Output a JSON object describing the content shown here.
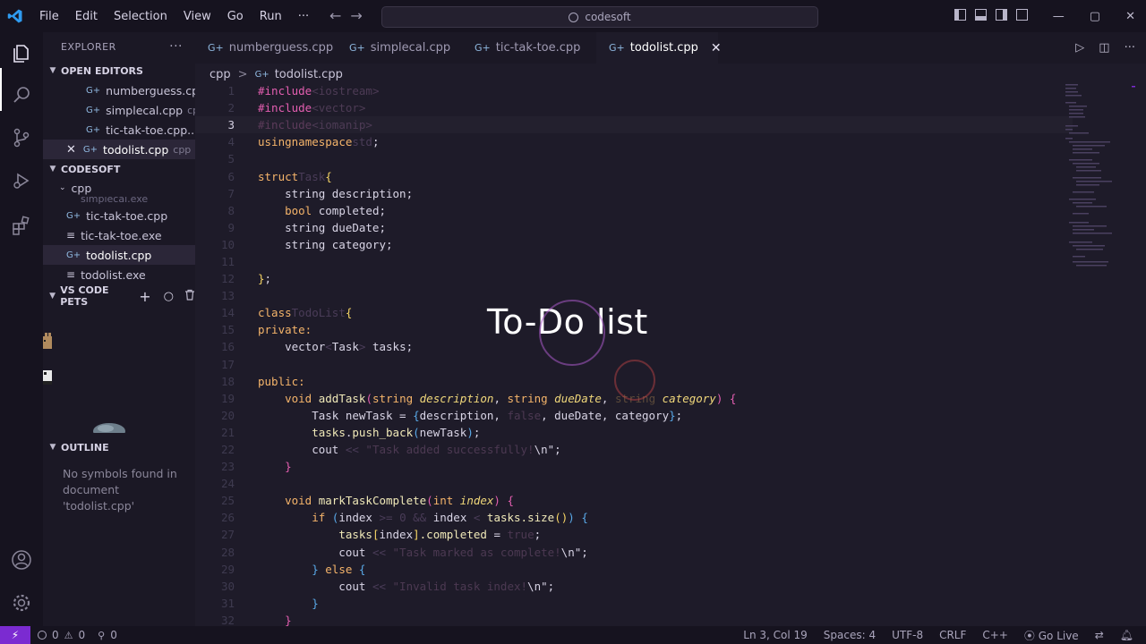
{
  "menu": {
    "file": "File",
    "edit": "Edit",
    "selection": "Selection",
    "view": "View",
    "go": "Go",
    "run": "Run",
    "more": "···"
  },
  "nav": {
    "back": "←",
    "forward": "→"
  },
  "command_center": {
    "text": "codesoft"
  },
  "window": {
    "minimize": "—",
    "maximize": "▢",
    "close": "✕"
  },
  "sidebar": {
    "title": "EXPLORER",
    "title_more": "···",
    "open_editors": {
      "label": "OPEN EDITORS",
      "items": [
        {
          "name": "numberguess.cp...",
          "meta": ""
        },
        {
          "name": "simplecal.cpp",
          "meta": "cpp"
        },
        {
          "name": "tic-tak-toe.cpp...",
          "meta": ""
        },
        {
          "name": "todolist.cpp",
          "meta": "cpp"
        }
      ]
    },
    "workspace": {
      "label": "CODESOFT",
      "folder": "cpp",
      "files": [
        {
          "name": "simplecal.exe"
        },
        {
          "name": "tic-tak-toe.cpp"
        },
        {
          "name": "tic-tak-toe.exe"
        },
        {
          "name": "todolist.cpp"
        },
        {
          "name": "todolist.exe"
        }
      ]
    },
    "pets": {
      "label": "VS CODE PETS",
      "add": "+",
      "ball": "○",
      "trash": "🗑"
    },
    "outline": {
      "label": "OUTLINE",
      "message": "No symbols found in document 'todolist.cpp'"
    }
  },
  "tabs": [
    {
      "label": "numberguess.cpp"
    },
    {
      "label": "simplecal.cpp"
    },
    {
      "label": "tic-tak-toe.cpp"
    },
    {
      "label": "todolist.cpp",
      "close": "✕"
    }
  ],
  "editor_actions": {
    "run": "▷",
    "split": "◫",
    "more": "···"
  },
  "breadcrumb": {
    "folder": "cpp",
    "sep": ">",
    "file": "todolist.cpp"
  },
  "code": {
    "lines": [
      "1",
      "2",
      "3",
      "4",
      "5",
      "6",
      "7",
      "8",
      "9",
      "10",
      "11",
      "12",
      "13",
      "14",
      "15",
      "16",
      "17",
      "18",
      "19",
      "20",
      "21",
      "22",
      "23",
      "24",
      "25",
      "26",
      "27",
      "28",
      "29",
      "30",
      "31",
      "32"
    ],
    "l1": {
      "pp": "#include",
      "inc": "<iostream>"
    },
    "l2": {
      "pp": "#include",
      "inc": "<vector>"
    },
    "l3": {
      "pp": "#include",
      "inc": "<iomanip>"
    },
    "l4": {
      "kw1": "using",
      "kw2": "namespace",
      "ns": "std",
      "semi": ";"
    },
    "l6": {
      "kw": "struct",
      "name": "Task",
      "brace": "{"
    },
    "l7": {
      "text": "    string description;"
    },
    "l8": {
      "kw": "    bool",
      "text": " completed;"
    },
    "l9": {
      "text": "    string dueDate;"
    },
    "l10": {
      "text": "    string category;"
    },
    "l12": {
      "brace": "}",
      "semi": ";"
    },
    "l14": {
      "kw": "class",
      "name": "TodoList",
      "brace": "{"
    },
    "l15": {
      "kw": "private:"
    },
    "l16": {
      "pre": "    vector",
      "lt": "<",
      "typ": "Task",
      "gt": ">",
      "post": " tasks;"
    },
    "l18": {
      "kw": "public:"
    },
    "l19": {
      "kw": "    void",
      "fn": " addTask",
      "p1": "(",
      "t1": "string",
      "a1": " description",
      "c1": ", ",
      "t2": "string",
      "a2": " dueDate",
      "c2": ", ",
      "t3": "string",
      "a3": " category",
      "p2": ")",
      "brace": " {"
    },
    "l20": {
      "pre": "        Task newTask = ",
      "ob": "{",
      "mid": "description, ",
      "lit": "false",
      "post": ", dueDate, category",
      "cb": "}",
      "semi": ";"
    },
    "l21": {
      "pre": "        ",
      "fn1": "tasks",
      "dot": ".",
      "fn2": "push_back",
      "p1": "(",
      "arg": "newTask",
      "p2": ")",
      "semi": ";"
    },
    "l22": {
      "pre": "        cout ",
      "op": "<<",
      "str": " \"Task added successfully!",
      "esc": "\\n",
      "end": "\";"
    },
    "l23": {
      "brace": "    }"
    },
    "l25": {
      "kw": "    void",
      "fn": " markTaskComplete",
      "p1": "(",
      "t": "int",
      "a": " index",
      "p2": ")",
      "brace": " {"
    },
    "l26": {
      "kw": "        if",
      "p1": " (",
      "t1": "index ",
      ">=": ">=",
      "z": " 0 ",
      "and": "&&",
      "t2": " index ",
      "lt": "<",
      "fn": " tasks.size",
      "pp": "()",
      "p2": ")",
      "brace": " {"
    },
    "l27": {
      "pre": "            ",
      "obj": "tasks",
      "lb": "[",
      "idx": "index",
      "rb": "]",
      "field": ".completed",
      "eq": " = ",
      "lit": "true",
      "semi": ";"
    },
    "l28": {
      "pre": "            cout ",
      "op": "<<",
      "str": " \"Task marked as complete!",
      "esc": "\\n",
      "end": "\";"
    },
    "l29": {
      "pre": "        ",
      "close": "}",
      "kw": " else",
      "brace": " {"
    },
    "l30": {
      "pre": "            cout ",
      "op": "<<",
      "str": " \"Invalid task index!",
      "esc": "\\n",
      "end": "\";"
    },
    "l31": {
      "brace": "        }"
    },
    "l32": {
      "brace": "    }"
    }
  },
  "overlay_title": "To-Do list",
  "status": {
    "remote": "⚡",
    "errors": "0",
    "warnings": "0",
    "ports": "0",
    "position": "Ln 3, Col 19",
    "spaces": "Spaces: 4",
    "encoding": "UTF-8",
    "eol": "CRLF",
    "language": "C++",
    "golive": "Go Live"
  },
  "colors": {
    "accent": "#7b2bd1",
    "bg": "#1e1b29",
    "keyword": "#f5b46a",
    "preprocessor": "#e35eb0"
  }
}
